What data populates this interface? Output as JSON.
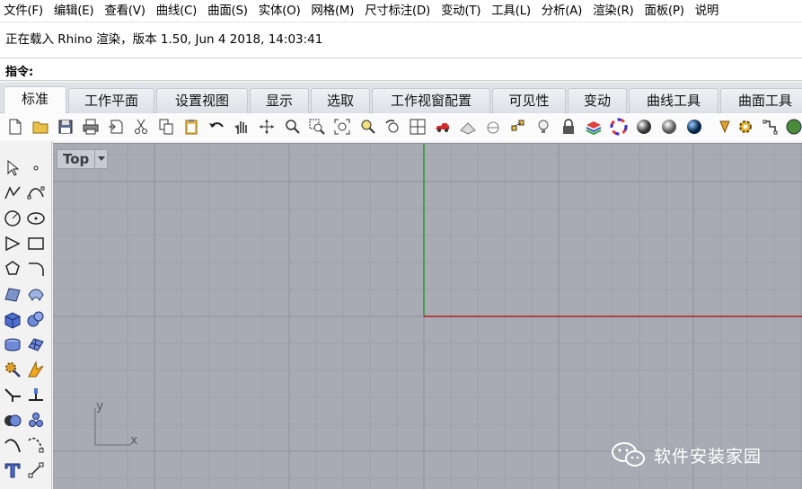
{
  "menubar": {
    "items": [
      "文件(F)",
      "编辑(E)",
      "查看(V)",
      "曲线(C)",
      "曲面(S)",
      "实体(O)",
      "网格(M)",
      "尺寸标注(D)",
      "变动(T)",
      "工具(L)",
      "分析(A)",
      "渲染(R)",
      "面板(P)",
      "说明"
    ]
  },
  "history": {
    "line": "正在载入 Rhino 渲染，版本 1.50, Jun  4 2018, 14:03:41"
  },
  "command": {
    "label": "指令:",
    "value": ""
  },
  "tabs": [
    "标准",
    "工作平面",
    "设置视图",
    "显示",
    "选取",
    "工作视窗配置",
    "可见性",
    "变动",
    "曲线工具",
    "曲面工具"
  ],
  "active_tab": "标准",
  "toolbar_icons": [
    "new-icon",
    "open-icon",
    "save-icon",
    "print-icon",
    "import-icon",
    "cut-icon",
    "copy-icon",
    "paste-icon",
    "undo-icon",
    "pan-icon",
    "rotate-view-icon",
    "zoom-icon",
    "zoom-window-icon",
    "zoom-extents-icon",
    "zoom-selected-icon",
    "undo-view-icon",
    "four-viewports-icon",
    "car-icon",
    "grid-plane-icon",
    "cplane-icon",
    "select-points-icon",
    "light-icon",
    "lock-icon",
    "layer-icon",
    "color-wheel-icon",
    "wireframe-sphere-icon",
    "shaded-sphere-icon",
    "rendered-sphere-icon",
    "cone-icon",
    "settings-gear-icon",
    "curve-edit-icon",
    "globe-icon"
  ],
  "left_tools": [
    "select-icon",
    "point-icon",
    "polyline-icon",
    "curve-icon",
    "circle-icon",
    "ellipse-icon",
    "arc-icon",
    "rectangle-icon",
    "polygon-icon",
    "fillet-icon",
    "surface-icon",
    "loft-icon",
    "box-icon",
    "sphere-icon",
    "cylinder-icon",
    "mesh-icon",
    "settings-icon",
    "explode-icon",
    "extend-icon",
    "trim-icon",
    "boolean-icon",
    "group-icon",
    "curve-tool-icon",
    "point-edit-icon",
    "text-icon",
    "dimension-icon"
  ],
  "viewport": {
    "title": "Top",
    "axis_y": "y",
    "axis_x": "x"
  },
  "watermark": {
    "text": "软件安装家园"
  },
  "colors": {
    "viewport_bg": "#a8abb3",
    "grid_minor": "#9ea1a9",
    "grid_major": "#8e9199",
    "x_axis": "#b32020",
    "y_axis": "#2f9a2f"
  }
}
